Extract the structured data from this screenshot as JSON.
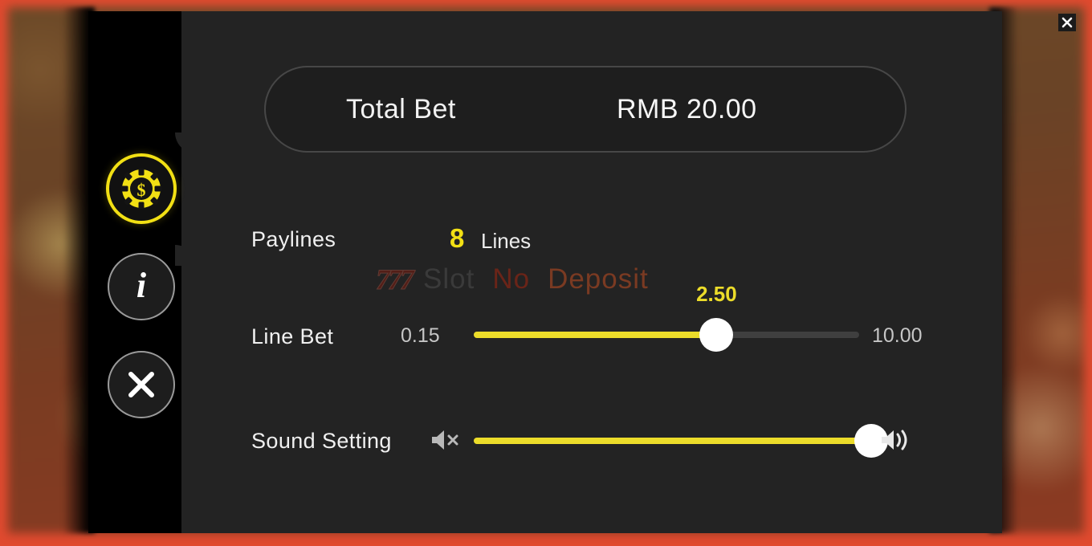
{
  "window": {
    "close_icon": "close-icon",
    "frame_color": "#e04a2f"
  },
  "sidebar": {
    "items": [
      {
        "name": "bet-settings",
        "icon": "casino-chip-icon",
        "active": true
      },
      {
        "name": "info",
        "icon": "info-icon",
        "label": "i",
        "active": false
      },
      {
        "name": "close-panel",
        "icon": "close-icon",
        "active": false
      }
    ]
  },
  "total_bet": {
    "label": "Total Bet",
    "value": "RMB 20.00"
  },
  "paylines": {
    "label": "Paylines",
    "count": "8",
    "unit": "Lines"
  },
  "line_bet": {
    "label": "Line Bet",
    "min": "0.15",
    "max": "10.00",
    "value": "2.50",
    "fill_percent": 63,
    "accent_color": "#ecdc2a"
  },
  "sound_setting": {
    "label": "Sound Setting",
    "mute_icon": "speaker-mute-icon",
    "volume_icon": "speaker-volume-icon",
    "fill_percent": 100,
    "accent_color": "#ecdc2a"
  },
  "watermark": {
    "logo": "777",
    "word1": "Slot",
    "word2": "No",
    "word3": "Deposit"
  }
}
